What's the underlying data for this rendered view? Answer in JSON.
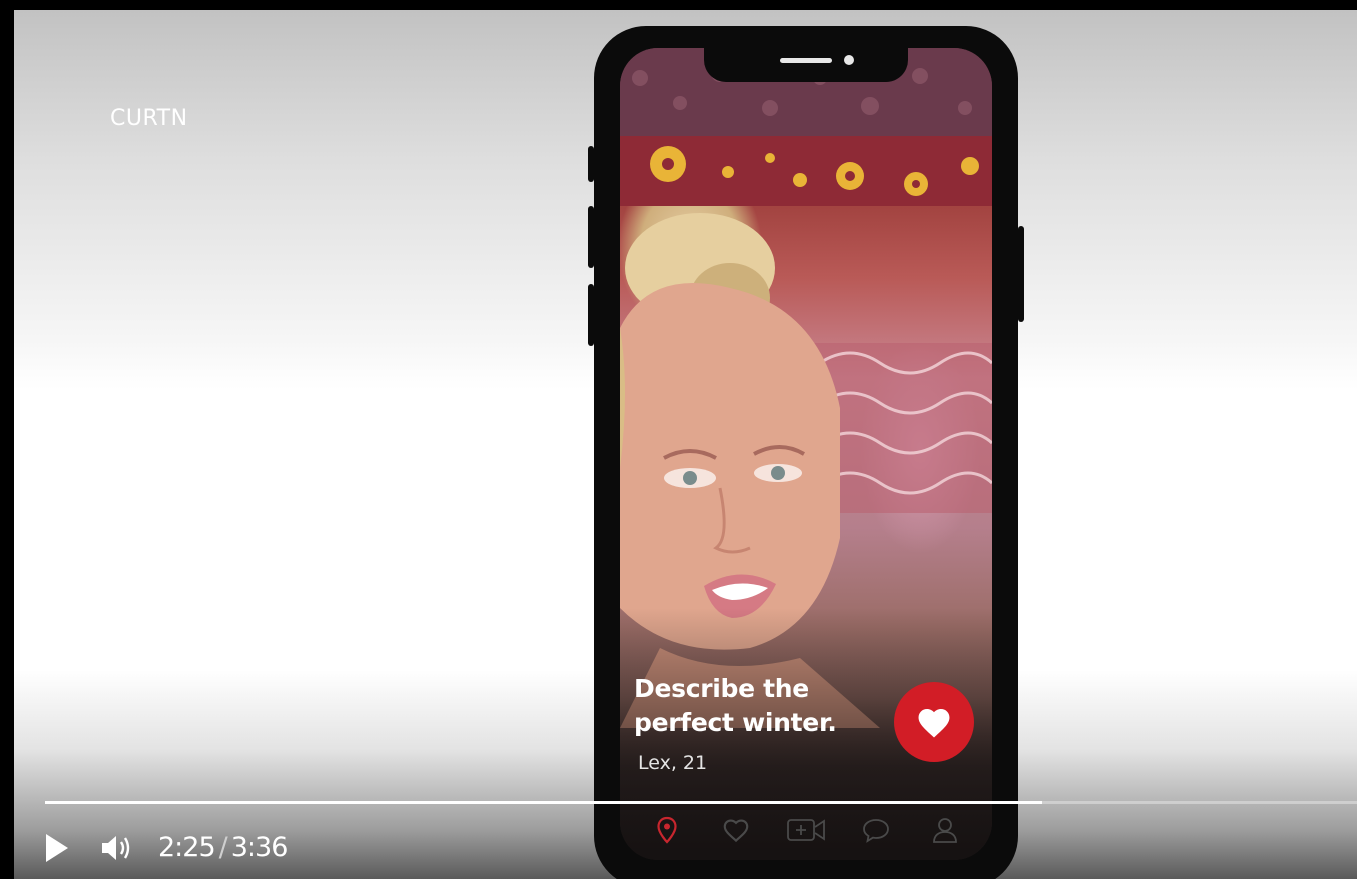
{
  "brand": {
    "name": "CURTN"
  },
  "card": {
    "prompt": "Describe the perfect winter.",
    "user": "Lex, 21"
  },
  "tabbar": {
    "items": [
      {
        "icon": "location-pin-icon",
        "active": true
      },
      {
        "icon": "heart-outline-icon",
        "active": false
      },
      {
        "icon": "video-add-icon",
        "active": false
      },
      {
        "icon": "chat-bubble-icon",
        "active": false
      },
      {
        "icon": "profile-icon",
        "active": false
      }
    ]
  },
  "player": {
    "current_time": "2:25",
    "separator": "/",
    "duration": "3:36",
    "progress_fraction": 0.76,
    "play_icon": "play-icon",
    "volume_icon": "volume-icon"
  },
  "colors": {
    "accent": "#d21d26",
    "active_tab": "#c8262e"
  }
}
